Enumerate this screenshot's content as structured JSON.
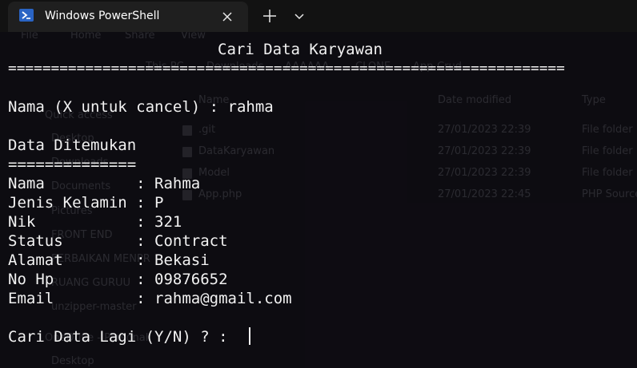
{
  "window": {
    "tab_title": "Windows PowerShell",
    "tab_icon": "powershell-icon",
    "accent_color": "#2a64c4"
  },
  "background_explorer": {
    "menu": [
      "File",
      "Home",
      "Share",
      "View"
    ],
    "breadcrumb": [
      "This PC",
      "Downloads",
      "AAAAAA",
      "CLONE",
      "App-Crud"
    ],
    "columns": [
      "Name",
      "Date modified",
      "Type"
    ],
    "sidebar": [
      "Quick access",
      "Desktop",
      "Downloads",
      "Documents",
      "Pictures",
      "FRONT END",
      "PERBAIKAN MENPR",
      "RUANG GURUU",
      "unzipper-master",
      "OneDrive - Personal",
      "Desktop"
    ],
    "files": [
      {
        "name": ".git",
        "date": "27/01/2023 22:39",
        "type": "File folder"
      },
      {
        "name": "DataKaryawan",
        "date": "27/01/2023 22:39",
        "type": "File folder"
      },
      {
        "name": "Model",
        "date": "27/01/2023 22:39",
        "type": "File folder"
      },
      {
        "name": "App.php",
        "date": "27/01/2023 22:45",
        "type": "PHP Source"
      }
    ]
  },
  "terminal": {
    "heading": "Cari Data Karyawan",
    "rule_long": "=================================================================",
    "prompt_name": "Nama (X untuk cancel) : rahma",
    "found_title": "Data Ditemukan",
    "rule_short": "==============",
    "fields": [
      "Nama          : Rahma",
      "Jenis Kelamin : P",
      "Nik           : 321",
      "Status        : Contract",
      "Alamat        : Bekasi",
      "No Hp         : 09876652",
      "Email         : rahma@gmail.com"
    ],
    "prompt_again": "Cari Data Lagi (Y/N) ? : "
  }
}
